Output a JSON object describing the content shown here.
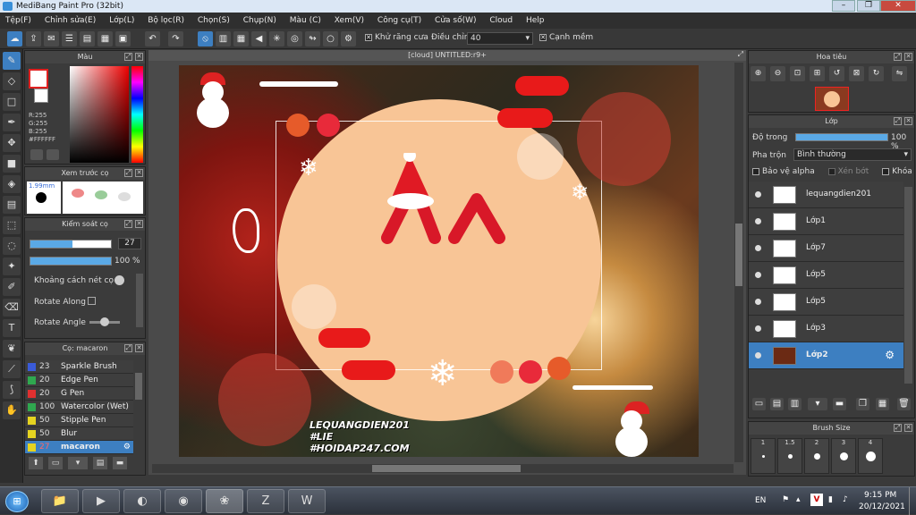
{
  "window": {
    "title": "MediBang Paint Pro (32bit)"
  },
  "menu": [
    "Tệp(F)",
    "Chỉnh sửa(E)",
    "Lớp(L)",
    "Bộ lọc(R)",
    "Chọn(S)",
    "Chụp(N)",
    "Màu (C)",
    "Xem(V)",
    "Công cụ(T)",
    "Cửa số(W)",
    "Cloud",
    "Help"
  ],
  "toolbar": {
    "antialias_label": "Khử răng cưa",
    "correction_label": "Điều chỉnh",
    "correction_value": "40",
    "snap_label": "Cạnh mềm"
  },
  "color_panel": {
    "title": "Màu",
    "r": "R:255",
    "g": "G:255",
    "b": "B:255",
    "hex": "#FFFFFF"
  },
  "preview_panel": {
    "title": "Xem trước cọ",
    "size": "1.99mm"
  },
  "brush_control": {
    "title": "Kiểm soát cọ",
    "size_value": "27",
    "opacity_value": "100 %",
    "spacing_label": "Khoảng cách nét cọ",
    "rotate_along_label": "Rotate Along",
    "rotate_angle_label": "Rotate Angle"
  },
  "brush_list": {
    "title": "Cọ: macaron",
    "items": [
      {
        "size": "23",
        "name": "Sparkle Brush",
        "color": "#3a5bd9"
      },
      {
        "size": "20",
        "name": "Edge Pen",
        "color": "#2fa84f"
      },
      {
        "size": "20",
        "name": "G Pen",
        "color": "#e03030"
      },
      {
        "size": "100",
        "name": "Watercolor (Wet)",
        "color": "#2fa84f"
      },
      {
        "size": "50",
        "name": "Stipple Pen",
        "color": "#e5d320"
      },
      {
        "size": "50",
        "name": "Blur",
        "color": "#e5d320"
      },
      {
        "size": "27",
        "name": "macaron",
        "color": "#e5d320"
      }
    ]
  },
  "canvas": {
    "title": "[cloud] UNTITLED:r9+",
    "watermark": [
      "LEQUANGDIEN201",
      "#LIE",
      "#HOIDAP247.COM"
    ]
  },
  "navigator": {
    "title": "Hoa tiêu"
  },
  "layer_panel": {
    "title": "Lớp",
    "opacity_label": "Độ trong",
    "opacity_value": "100 %",
    "blend_label": "Pha trộn",
    "blend_value": "Bình thường",
    "protect_alpha": "Bảo vệ alpha",
    "clipping": "Xén bớt",
    "lock": "Khóa",
    "layers": [
      "lequangdien201",
      "Lớp1",
      "Lớp7",
      "Lớp5",
      "Lớp5",
      "Lớp3",
      "Lớp2"
    ]
  },
  "brush_size": {
    "title": "Brush Size",
    "sizes": [
      "1",
      "1.5",
      "2",
      "3",
      "4"
    ]
  },
  "tray": {
    "lang": "EN",
    "time": "9:15 PM",
    "date": "20/12/2021"
  }
}
